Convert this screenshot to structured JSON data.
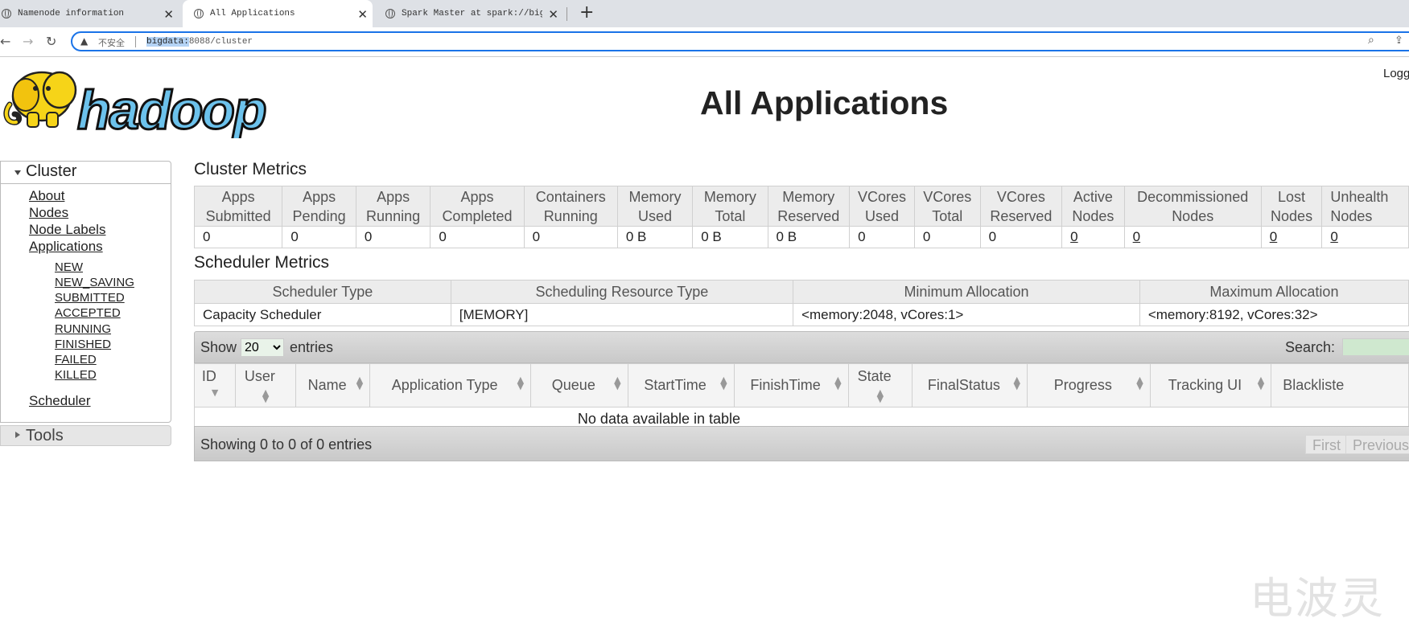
{
  "browser": {
    "tabs": [
      {
        "title": "Namenode information"
      },
      {
        "title": "All Applications"
      },
      {
        "title": "Spark Master at spark://bigda"
      }
    ],
    "address": {
      "security_label": "不安全",
      "host": "bigdata:",
      "path": "8088/cluster"
    }
  },
  "header": {
    "logo_text": "hadoop",
    "title": "All Applications",
    "logged_in": "Logg"
  },
  "sidebar": {
    "cluster_label": "Cluster",
    "links": [
      "About",
      "Nodes",
      "Node Labels",
      "Applications"
    ],
    "app_states": [
      "NEW",
      "NEW_SAVING",
      "SUBMITTED",
      "ACCEPTED",
      "RUNNING",
      "FINISHED",
      "FAILED",
      "KILLED"
    ],
    "scheduler": "Scheduler",
    "tools_label": "Tools"
  },
  "cluster_metrics": {
    "title": "Cluster Metrics",
    "headers": [
      [
        "Apps",
        "Submitted"
      ],
      [
        "Apps",
        "Pending"
      ],
      [
        "Apps",
        "Running"
      ],
      [
        "Apps",
        "Completed"
      ],
      [
        "Containers",
        "Running"
      ],
      [
        "Memory",
        "Used"
      ],
      [
        "Memory",
        "Total"
      ],
      [
        "Memory",
        "Reserved"
      ],
      [
        "VCores",
        "Used"
      ],
      [
        "VCores",
        "Total"
      ],
      [
        "VCores",
        "Reserved"
      ],
      [
        "Active",
        "Nodes"
      ],
      [
        "Decommissioned",
        "Nodes"
      ],
      [
        "Lost",
        "Nodes"
      ],
      [
        "Unhealth",
        "Nodes"
      ]
    ],
    "values": [
      "0",
      "0",
      "0",
      "0",
      "0",
      "0 B",
      "0 B",
      "0 B",
      "0",
      "0",
      "0",
      "0",
      "0",
      "0",
      "0"
    ],
    "linked": [
      false,
      false,
      false,
      false,
      false,
      false,
      false,
      false,
      false,
      false,
      false,
      true,
      true,
      true,
      true
    ]
  },
  "scheduler_metrics": {
    "title": "Scheduler Metrics",
    "headers": [
      "Scheduler Type",
      "Scheduling Resource Type",
      "Minimum Allocation",
      "Maximum Allocation"
    ],
    "values": [
      "Capacity Scheduler",
      "[MEMORY]",
      "<memory:2048, vCores:1>",
      "<memory:8192, vCores:32>"
    ]
  },
  "apps_table": {
    "show_label": "Show",
    "page_size": "20",
    "entries_label": "entries",
    "search_label": "Search:",
    "columns": [
      "ID",
      "User",
      "Name",
      "Application Type",
      "Queue",
      "StartTime",
      "FinishTime",
      "State",
      "FinalStatus",
      "Progress",
      "Tracking UI",
      "Blacklisted"
    ],
    "empty_message": "No data available in table",
    "info": "Showing 0 to 0 of 0 entries",
    "pager": [
      "First",
      "Previous"
    ]
  },
  "watermark": "电波灵"
}
